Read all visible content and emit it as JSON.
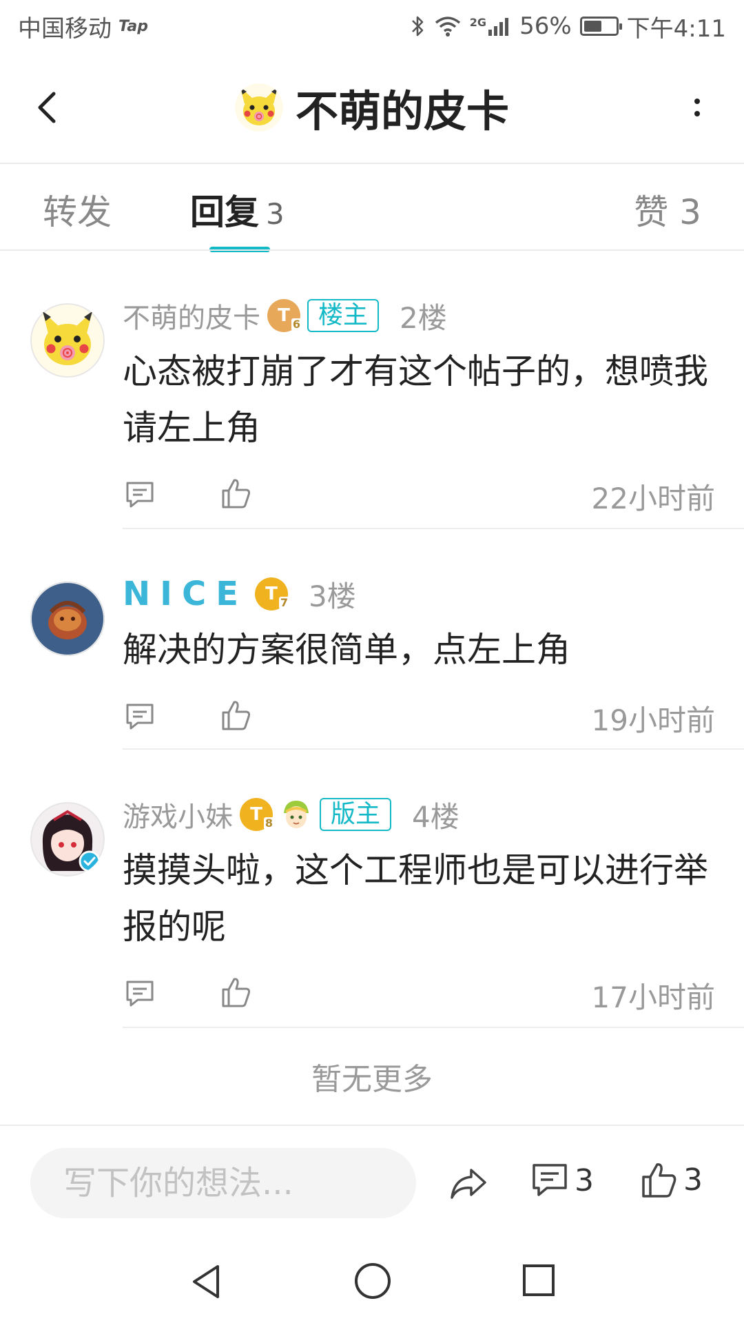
{
  "status_bar": {
    "carrier": "中国移动",
    "carrier_app": "Tap",
    "network": "2G",
    "battery": "56%",
    "battery_level": 0.56,
    "time": "下午4:11"
  },
  "header": {
    "title": "不萌的皮卡"
  },
  "tabs": {
    "forward": "转发",
    "reply": "回复",
    "reply_count": "3",
    "likes": "赞 3",
    "active": "reply"
  },
  "comments": [
    {
      "author": "不萌的皮卡",
      "level": "T",
      "level_sub": "6",
      "badge": "楼主",
      "floor": "2楼",
      "text": "心态被打崩了才有这个帖子的，想喷我请左上角",
      "time": "22小时前"
    },
    {
      "author": "NICE",
      "level": "T",
      "level_sub": "7",
      "floor": "3楼",
      "text": "解决的方案很简单，点左上角",
      "time": "19小时前"
    },
    {
      "author": "游戏小妹",
      "level": "T",
      "level_sub": "8",
      "badge": "版主",
      "floor": "4楼",
      "text": "摸摸头啦，这个工程师也是可以进行举报的呢",
      "time": "17小时前"
    }
  ],
  "footer_note": "暂无更多",
  "input_bar": {
    "placeholder": "写下你的想法...",
    "comment_count": "3",
    "like_count": "3"
  },
  "colors": {
    "accent": "#14b9c8",
    "nice_name": "#3bb6d9",
    "muted_text": "#999999",
    "level_orange": "#e8a85a",
    "level_gold": "#f0b21e"
  }
}
